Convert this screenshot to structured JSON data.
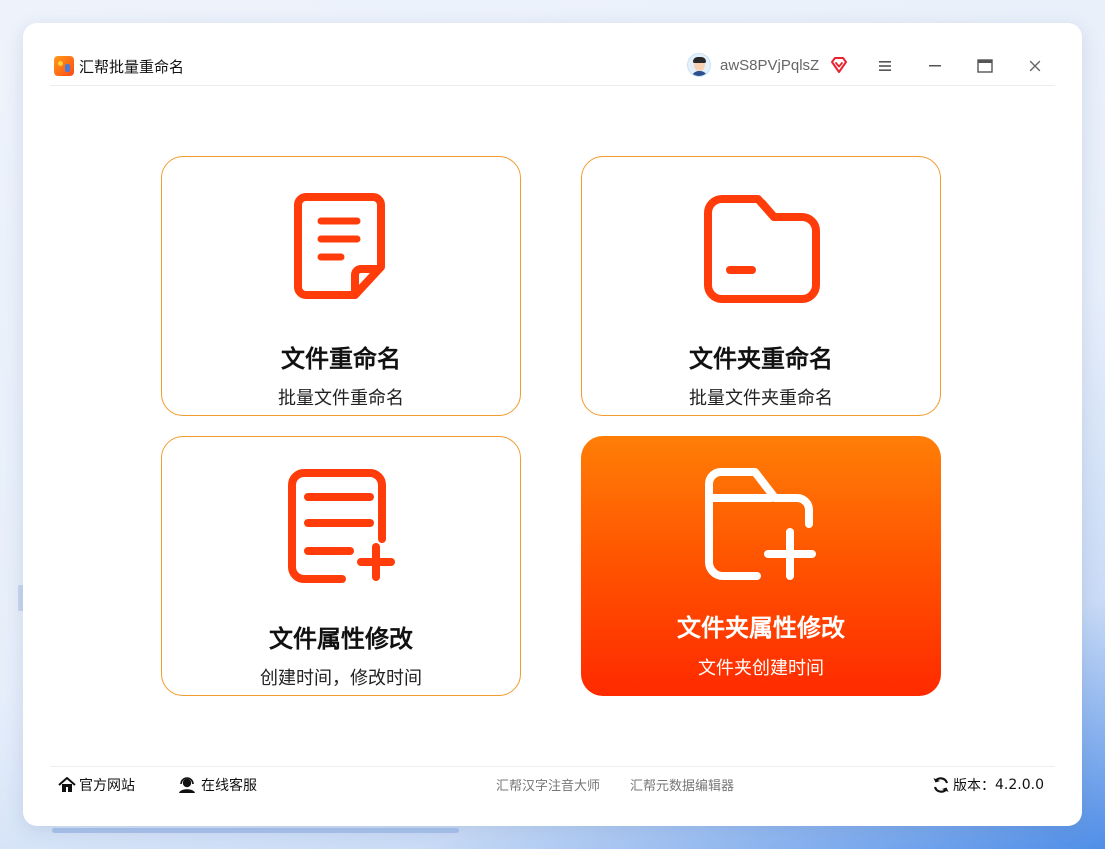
{
  "app": {
    "title": "汇帮批量重命名"
  },
  "user": {
    "name": "awS8PVjPqlsZ"
  },
  "cards": [
    {
      "title": "文件重命名",
      "subtitle": "批量文件重命名"
    },
    {
      "title": "文件夹重命名",
      "subtitle": "批量文件夹重命名"
    },
    {
      "title": "文件属性修改",
      "subtitle": "创建时间，修改时间"
    },
    {
      "title": "文件夹属性修改",
      "subtitle": "文件夹创建时间"
    }
  ],
  "footer": {
    "official_site": "官方网站",
    "online_service": "在线客服",
    "links": [
      "汇帮汉字注音大师",
      "汇帮元数据编辑器"
    ],
    "version_label": "版本：",
    "version": "4.2.0.0"
  },
  "colors": {
    "accent": "#ff3c0a",
    "card_border": "#f29b2f",
    "active_gradient_top": "#ff7e06",
    "active_gradient_bottom": "#ff2a00"
  }
}
